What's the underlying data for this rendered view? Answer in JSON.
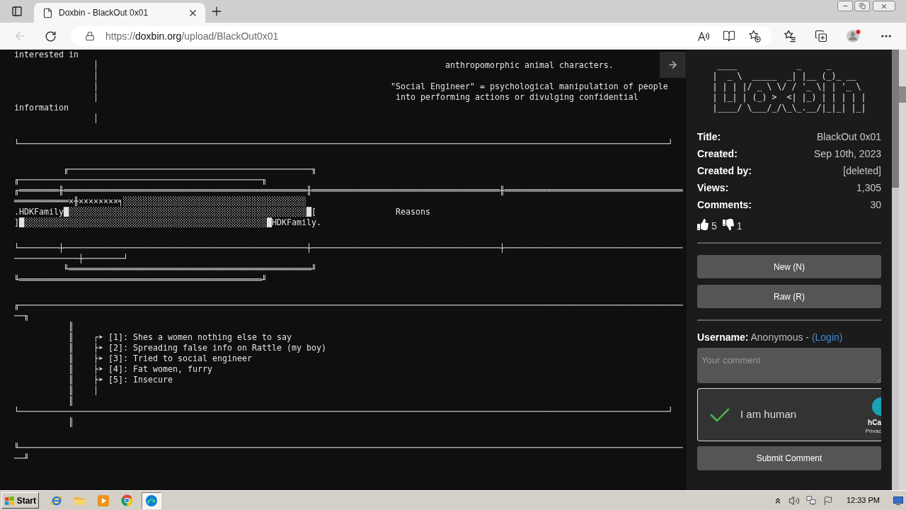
{
  "browser": {
    "tabs": [
      {
        "title": "Doxbin - BlackOut 0x01",
        "selected": true
      }
    ],
    "back": {
      "disabled": true
    },
    "address_bar": {
      "scheme": "https://",
      "host": "doxbin.org",
      "path": "/upload/BlackOut0x01"
    }
  },
  "paste": {
    "blocks": [
      [
        "interested in",
        "                │                                                                      anthropomorphic animal characters.",
        "                │",
        "                │                                                           \"Social Engineer\" = psychological manipulation of people",
        "                │                                                            into performing actions or divulging confidential",
        "information",
        "                │"
      ],
      [
        "└───────────────────────────────────────────────────────────────────────────────────────────────────────────────────────────────────┘"
      ],
      [
        "          ╓─────────────────────────────────────────────────╖",
        "╓─────────────────────────────────────────────────╖",
        "╓════════╫═════════════════════════════════════════════════╫══════════════════════════════════════╫════════════════════════════════════",
        "═══════════×╫××××××××╕░░░░░░░░░░░░░░░░░░░░░░░░░░░░░░░░░░░░░",
        ".HDKFamily█░░░░░░░░░░░░░░░░░░░░░░░░░░░░░░░░░░░░░░░░░░░░░░░░█[                Reasons",
        "]█░░░░░░░░░░░░░░░░░░░░░░░░░░░░░░░░░░░░░░░░░░░░░░░░░█HDKFamily."
      ],
      [
        "└────────┼─────────────────────────────────────────────────┼──────────────────────────────────────┼────────────────────────────────────",
        "─────────────┼────────┘",
        "          ╙═════════════════════════════════════════════════╜",
        "╙═════════════════════════════════════════════════╜"
      ],
      [
        "╓──────────────────────────────────────────────────────────────────────────────────────────────────────────────────────────────────────",
        "──╖",
        "           ║",
        "           ║    ┌➤ [1]: Shes a women nothing else to say",
        "           ║    ├➤ [2]: Spreading false info on Rattle (my boy)",
        "           ║    ├➤ [3]: Tried to social engineer",
        "           ║    ├➤ [4]: Fat women, furry",
        "           ║    ├➤ [5]: Insecure",
        "           ║    │",
        "           ║",
        "└───────────────────────────────────────────────────────────────────────────────────────────────────────────────────────────────────┘",
        "           ║"
      ],
      [
        "╙──────────────────────────────────────────────────────────────────────────────────────────────────────────────────────────────────────",
        "──╜"
      ]
    ]
  },
  "sidebar": {
    "logo_lines": [
      " ____            _     _       ",
      "|  _ \\  _____  _| |__ (_)_ __  ",
      "| | | |/ _ \\ \\/ / '_ \\| | '_ \\ ",
      "| |_| | (_) >  <| |_) | | | | |",
      "|____/ \\___/_/\\_\\_.__/|_|_| |_|"
    ],
    "info": [
      {
        "label": "Title:",
        "value": "BlackOut 0x01"
      },
      {
        "label": "Created:",
        "value": "Sep 10th, 2023"
      },
      {
        "label": "Created by:",
        "value": "[deleted]"
      },
      {
        "label": "Views:",
        "value": "1,305"
      },
      {
        "label": "Comments:",
        "value": "30"
      }
    ],
    "votes": {
      "up": "5",
      "down": "1"
    },
    "buttons": [
      "New (N)",
      "Raw (R)"
    ],
    "comment_form": {
      "username_label": "Username:",
      "username": "Anonymous -",
      "login_link": "(Login)",
      "placeholder": "Your comment",
      "captcha": {
        "checked": true,
        "label": "I am human",
        "brand": "hCa",
        "privacy": "Privac"
      },
      "submit": "Submit Comment"
    }
  },
  "taskbar": {
    "start": "Start",
    "apps": [
      {
        "kind": "ie",
        "selected": false
      },
      {
        "kind": "folder",
        "selected": false
      },
      {
        "kind": "media",
        "selected": false
      },
      {
        "kind": "chrome",
        "selected": false
      },
      {
        "kind": "edge",
        "selected": true
      }
    ],
    "time": "12:33 PM"
  }
}
